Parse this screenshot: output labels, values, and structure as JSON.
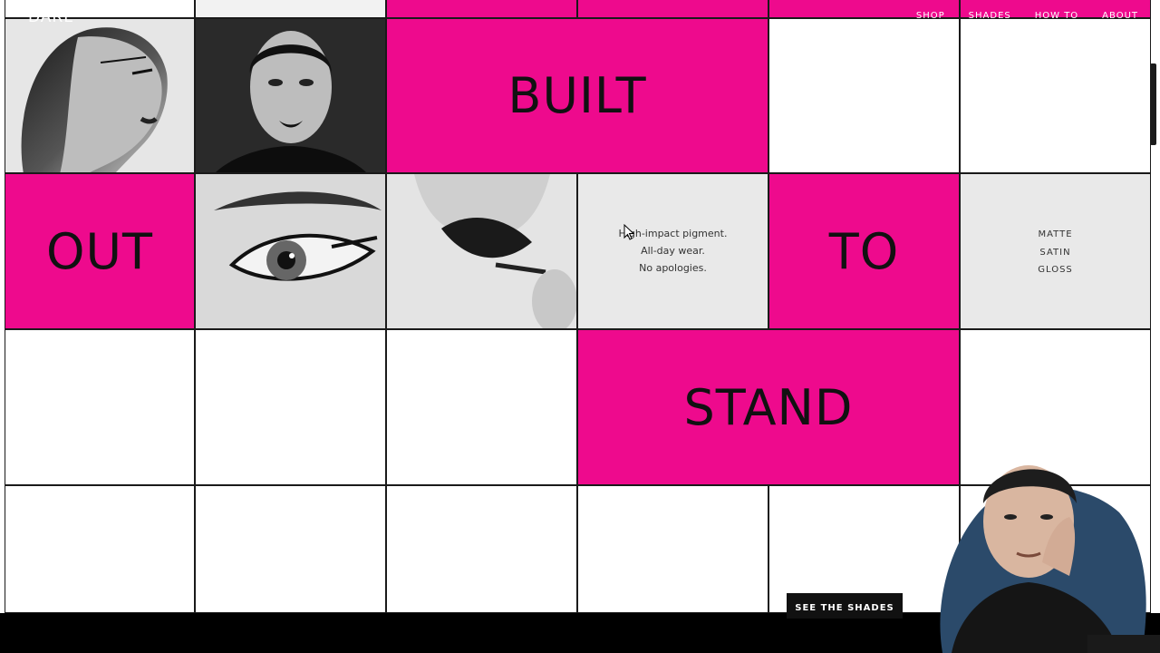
{
  "header": {
    "logo": "DARE",
    "nav": [
      "SHOP",
      "SHADES",
      "HOW TO",
      "ABOUT"
    ]
  },
  "grid": {
    "words": {
      "built": "BUILT",
      "out": "OUT",
      "to": "TO",
      "stand": "STAND"
    },
    "copy": [
      "High-impact pigment.",
      "All-day wear.",
      "No apologies."
    ],
    "finishes": [
      "MATTE",
      "SATIN",
      "GLOSS"
    ]
  },
  "cta": {
    "label": "SEE THE SHADES"
  },
  "colors": {
    "accent": "#ee0a8d",
    "panel": "#e9e9e9",
    "ink": "#111111"
  },
  "icons": [
    "mouse-cursor-icon"
  ]
}
